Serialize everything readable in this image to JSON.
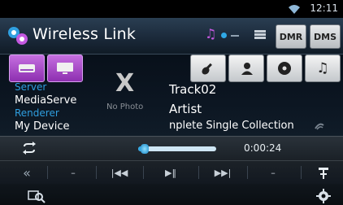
{
  "status": {
    "clock": "12:11"
  },
  "header": {
    "title": "Wireless Link",
    "dmr_label": "DMR",
    "dms_label": "DMS"
  },
  "sources": {
    "server_label": "Server",
    "server_name": "MediaServe",
    "renderer_label": "Renderer",
    "renderer_name": "My Device"
  },
  "photo": {
    "no_photo_text": "No Photo",
    "placeholder_glyph": "X"
  },
  "track": {
    "title": "Track02",
    "artist": "Artist",
    "album": "nplete Single Collection"
  },
  "playback": {
    "time": "0:00:24",
    "progress": 0.08
  },
  "icons": {
    "wifi": "wifi-icon",
    "app": "wireless-link-icon",
    "music": "music-note-icon",
    "category_1": "guitar-icon",
    "category_2": "artist-icon",
    "category_3": "disc-icon",
    "category_4": "music-note-icon",
    "repeat": "repeat-icon",
    "prev_page": "double-chevron-left-icon",
    "prev_track": "previous-track-icon",
    "play_pause": "play-pause-icon",
    "next_track": "next-track-icon",
    "tune": "tune-icon",
    "search": "search-icon",
    "settings": "settings-icon"
  },
  "colors": {
    "accent_blue": "#2fa8e6",
    "source_purple": "#a646cc",
    "header_bg": "#1a2838"
  }
}
